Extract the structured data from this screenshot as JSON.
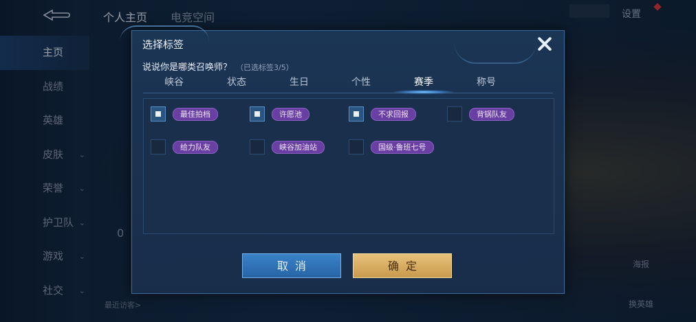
{
  "background": {
    "nav": [
      {
        "label": "主页",
        "active": true,
        "chevron": false
      },
      {
        "label": "战绩",
        "active": false,
        "chevron": false
      },
      {
        "label": "英雄",
        "active": false,
        "chevron": false
      },
      {
        "label": "皮肤",
        "active": false,
        "chevron": true
      },
      {
        "label": "荣誉",
        "active": false,
        "chevron": true
      },
      {
        "label": "护卫队",
        "active": false,
        "chevron": true
      },
      {
        "label": "游戏",
        "active": false,
        "chevron": true
      },
      {
        "label": "社交",
        "active": false,
        "chevron": true
      }
    ],
    "top_tabs": [
      "个人主页",
      "电竞空间"
    ],
    "settings_label": "设置",
    "recent_visitors": "最近访客>",
    "count_zero": "0",
    "poster_label": "海报",
    "change_hero_label": "换英雄"
  },
  "dialog": {
    "title": "选择标签",
    "question": "说说你是哪类召唤师？",
    "selected_hint": "（已选标签3/5）",
    "tabs": [
      "峡谷",
      "状态",
      "生日",
      "个性",
      "赛季",
      "称号"
    ],
    "active_tab": "赛季",
    "tags": [
      {
        "label": "最佳拍档",
        "checked": true
      },
      {
        "label": "许愿池",
        "checked": true
      },
      {
        "label": "不求回报",
        "checked": true
      },
      {
        "label": "背锅队友",
        "checked": false
      },
      {
        "label": "给力队友",
        "checked": false
      },
      {
        "label": "峡谷加油站",
        "checked": false
      },
      {
        "label": "国级·鲁班七号",
        "checked": false
      }
    ],
    "cancel_label": "取消",
    "ok_label": "确定"
  }
}
